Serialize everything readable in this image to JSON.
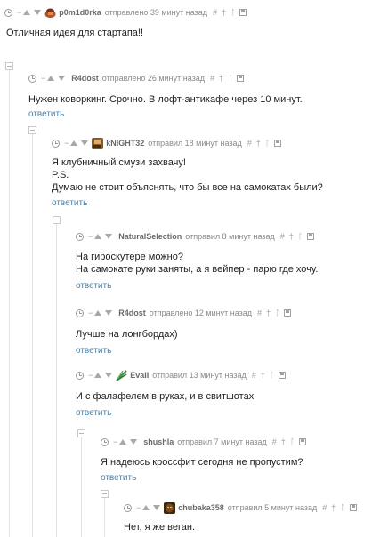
{
  "comments": [
    {
      "nick": "p0m1d0rka",
      "meta": "отправлено 39 минут назад",
      "lines": [
        "Отличная идея для стартапа!!"
      ],
      "avatar_color": "#b0502c"
    },
    {
      "nick": "R4dost",
      "meta": "отправлено 26 минут назад",
      "lines": [
        "Нужен коворкинг. Срочно. В лофт-антикафе через 10 минут."
      ],
      "reply": "ответить"
    },
    {
      "nick": "kNIGHT32",
      "meta": "отправил 18 минут назад",
      "lines": [
        "Я клубничный смузи захвачу!",
        "P.S.",
        "Думаю не стоит объяснять, что бы все на самокатах были?"
      ],
      "reply": "ответить",
      "avatar_color": "#8a5a22"
    },
    {
      "nick": "NaturalSelection",
      "meta": "отправил 8 минут назад",
      "lines": [
        "На гироскутере можно?",
        "На самокате руки заняты, а я вейпер - парю где хочу."
      ],
      "reply": "ответить"
    },
    {
      "nick": "R4dost",
      "meta": "отправлено 12 минут назад",
      "lines": [
        "Лучше на лонгбордах)"
      ],
      "reply": "ответить"
    },
    {
      "nick": "EvaII",
      "meta": "отправил 13 минут назад",
      "lines": [
        "И с фалафелем в руках, и в свитшотах"
      ],
      "reply": "ответить",
      "avatar_color": "#3f8f3f"
    },
    {
      "nick": "shushla",
      "meta": "отправил 7 минут назад",
      "lines": [
        "Я надеюсь кроссфит сегодня не пропустим?"
      ],
      "reply": "ответить"
    },
    {
      "nick": "chubaka358",
      "meta": "отправил 5 минут назад",
      "lines": [
        "Нет, я же веган."
      ],
      "avatar_color": "#7a4a18"
    }
  ],
  "icons": {
    "hash": "#",
    "plus": "†",
    "reply_arrow": "ᛚ"
  },
  "vote_minus": "−"
}
